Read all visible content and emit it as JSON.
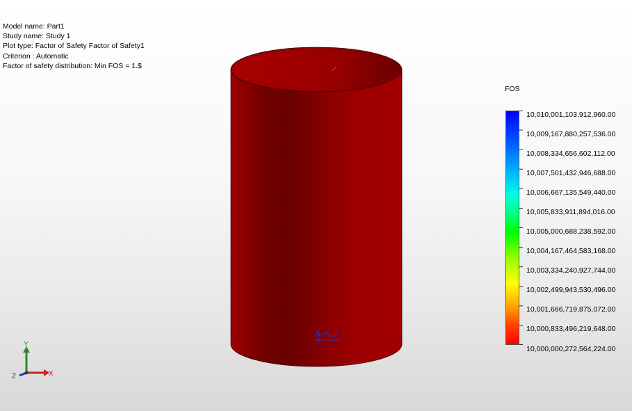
{
  "plot_info": {
    "model_name": "Model name: Part1",
    "study_name": "Study name: Study 1",
    "plot_type": "Plot type: Factor of Safety Factor of Safety1",
    "criterion": "Criterion : Automatic",
    "distribution": "Factor of safety distribution: Min FOS = 1.$"
  },
  "legend": {
    "title": "FOS",
    "labels": [
      "10,010,001,103,912,960.00",
      "10,009,167,880,257,536.00",
      "10,008,334,656,602,112.00",
      "10,007,501,432,946,688.00",
      "10,006,667,135,549,440.00",
      "10,005,833,911,894,016.00",
      "10,005,000,688,238,592.00",
      "10,004,167,464,583,168.00",
      "10,003,334,240,927,744.00",
      "10,002,499,943,530,496.00",
      "10,001,666,719,875,072.00",
      "10,000,833,496,219,648.00",
      "10,000,000,272,564,224.00"
    ],
    "color_max": "#0000ff",
    "color_min": "#ff0000"
  },
  "model": {
    "body_color": "#a00000",
    "shadow_color": "#6a0000",
    "rim_color": "#800000"
  },
  "triad": {
    "x_label": "X",
    "y_label": "Y",
    "z_label": "Z",
    "x_color": "#cc2222",
    "y_color": "#2a8a2a",
    "z_color": "#2a2acc"
  }
}
